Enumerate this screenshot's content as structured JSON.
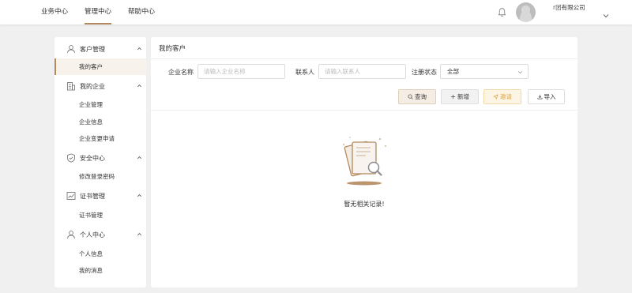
{
  "nav": {
    "items": [
      {
        "label": "业务中心"
      },
      {
        "label": "管理中心"
      },
      {
        "label": "帮助中心"
      }
    ],
    "company": "有限公司",
    "company_prefix": "r团"
  },
  "sidebar": {
    "groups": [
      {
        "label": "客户管理",
        "icon": "user-icon",
        "items": [
          {
            "label": "我的客户"
          }
        ]
      },
      {
        "label": "我的企业",
        "icon": "building-icon",
        "items": [
          {
            "label": "企业管理"
          },
          {
            "label": "企业信息"
          },
          {
            "label": "企业变更申请"
          }
        ]
      },
      {
        "label": "安全中心",
        "icon": "shield-icon",
        "items": [
          {
            "label": "修改登录密码"
          }
        ]
      },
      {
        "label": "证书管理",
        "icon": "chart-icon",
        "items": [
          {
            "label": "证书管理"
          }
        ]
      },
      {
        "label": "个人中心",
        "icon": "user-icon",
        "items": [
          {
            "label": "个人信息"
          },
          {
            "label": "我的消息"
          }
        ]
      }
    ]
  },
  "main": {
    "title": "我的客户",
    "filters": {
      "company_label": "企业名称",
      "company_placeholder": "请输入企业名称",
      "contact_label": "联系人",
      "contact_placeholder": "请输入联系人",
      "status_label": "注册状态",
      "status_value": "全部"
    },
    "buttons": {
      "query": "查询",
      "add": "新增",
      "invite": "邀请",
      "import": "导入"
    },
    "empty_text": "暂无相关记录!"
  },
  "colors": {
    "accent": "#b28a5e",
    "invite": "#d9a444",
    "background": "#f0f0f1"
  }
}
